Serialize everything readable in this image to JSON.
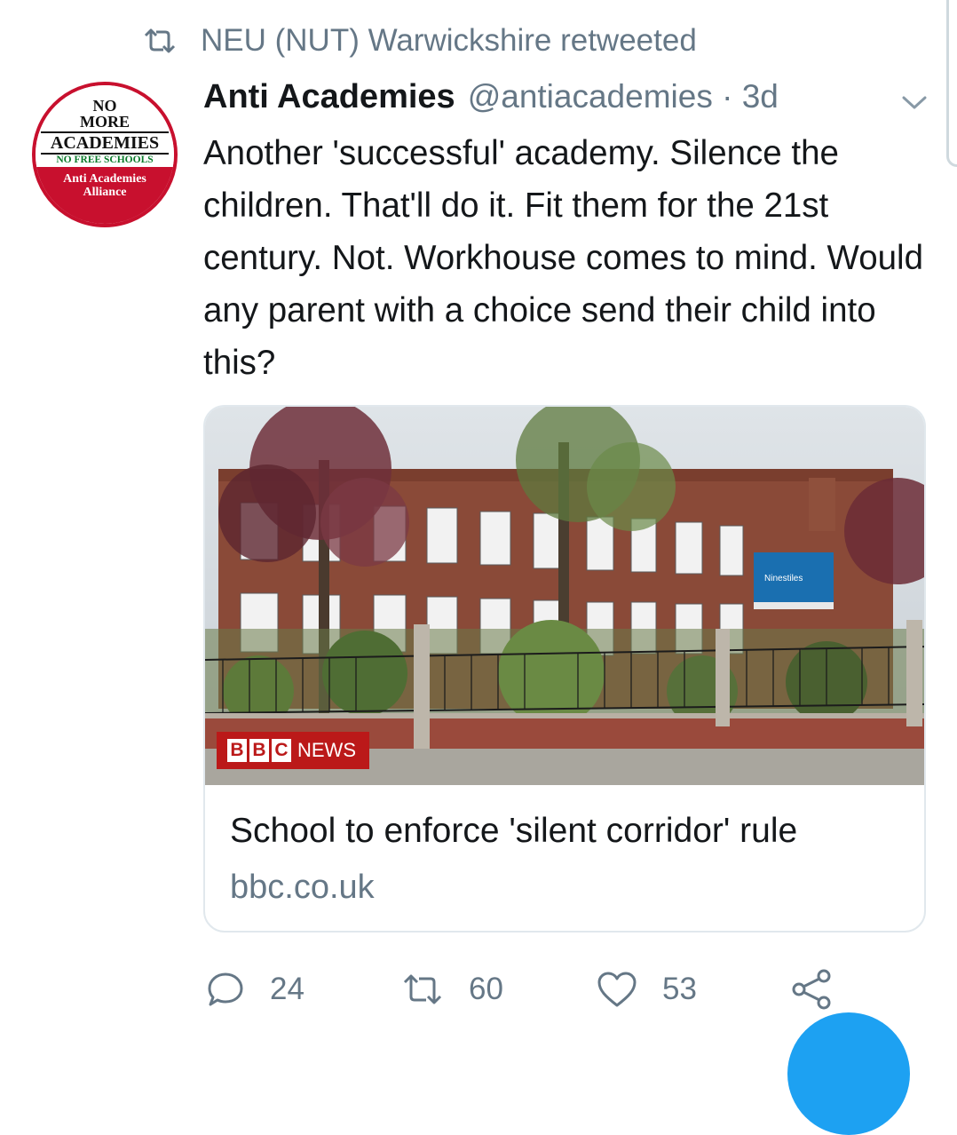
{
  "retweet_context": {
    "text": "NEU (NUT) Warwickshire retweeted",
    "icon": "retweet-icon"
  },
  "avatar": {
    "line1": "NO",
    "line2": "MORE",
    "line3": "ACADEMIES",
    "line4": "NO FREE SCHOOLS",
    "line5": "Anti Academies",
    "line6": "Alliance",
    "url": "www.antiacademies.org.uk"
  },
  "tweet": {
    "author_name": "Anti Academies",
    "handle_time": "@antiacademies · 3d",
    "text": "Another 'successful' academy. Silence the children. That'll do it. Fit them for the 21st century. Not. Workhouse comes to mind. Would any parent with a choice send their child into this?"
  },
  "card": {
    "badge_b1": "B",
    "badge_b2": "B",
    "badge_c": "C",
    "badge_news": "NEWS",
    "sign_text": "Ninestiles",
    "title": "School to enforce 'silent corridor' rule",
    "domain": "bbc.co.uk"
  },
  "actions": {
    "replies": "24",
    "retweets": "60",
    "likes": "53"
  },
  "colors": {
    "secondary_text": "#657786",
    "primary_text": "#14171a",
    "accent": "#1da1f2",
    "bbc_red": "#bb1919"
  }
}
